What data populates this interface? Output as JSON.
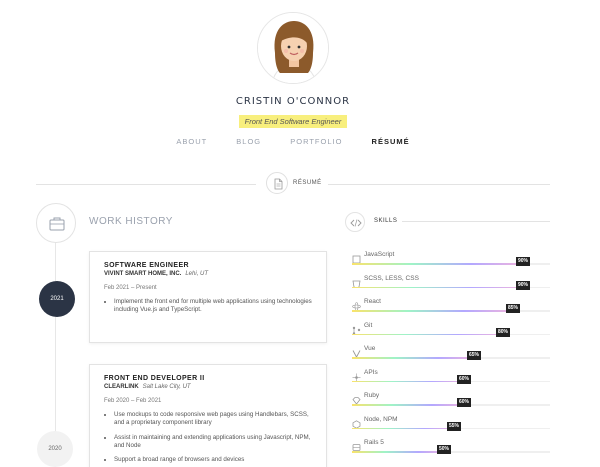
{
  "profile": {
    "name": "CRISTIN O'CONNOR",
    "subtitle": "Front End Software Engineer"
  },
  "nav": {
    "items": [
      {
        "label": "ABOUT"
      },
      {
        "label": "BLOG"
      },
      {
        "label": "PORTFOLIO"
      },
      {
        "label": "RÉSUMÉ",
        "active": true
      }
    ]
  },
  "section": {
    "label": "RÉSUMÉ"
  },
  "work": {
    "title": "WORK HISTORY",
    "years": [
      "2021",
      "2020"
    ],
    "jobs": [
      {
        "title": "SOFTWARE ENGINEER",
        "company": "VIVINT SMART HOME, INC.",
        "location": "Lehi, UT",
        "dates": "Feb 2021 – Present",
        "bullets": [
          "Implement the front end for multiple web applications using technologies including Vue.js and TypeScript."
        ]
      },
      {
        "title": "FRONT END DEVELOPER II",
        "company": "CLEARLINK",
        "location": "Salt Lake City, UT",
        "dates": "Feb 2020 – Feb 2021",
        "bullets": [
          "Use mockups to code responsive web pages using Handlebars, SCSS, and a proprietary component library",
          "Assist in maintaining and extending applications using Javascript, NPM, and Node",
          "Support a broad range of browsers and devices"
        ]
      }
    ]
  },
  "skills": {
    "title": "SKILLS",
    "items": [
      {
        "name": "JavaScript",
        "percent": 90,
        "label": "90%",
        "icon": "js-icon"
      },
      {
        "name": "SCSS, LESS, CSS",
        "percent": 90,
        "label": "90%",
        "icon": "css-icon"
      },
      {
        "name": "React",
        "percent": 85,
        "label": "85%",
        "icon": "react-icon"
      },
      {
        "name": "Git",
        "percent": 80,
        "label": "80%",
        "icon": "git-icon"
      },
      {
        "name": "Vue",
        "percent": 65,
        "label": "65%",
        "icon": "vue-icon"
      },
      {
        "name": "APIs",
        "percent": 60,
        "label": "60%",
        "icon": "api-icon"
      },
      {
        "name": "Ruby",
        "percent": 60,
        "label": "60%",
        "icon": "ruby-icon"
      },
      {
        "name": "Node, NPM",
        "percent": 55,
        "label": "55%",
        "icon": "node-icon"
      },
      {
        "name": "Rails 5",
        "percent": 50,
        "label": "50%",
        "icon": "rails-icon"
      }
    ]
  }
}
